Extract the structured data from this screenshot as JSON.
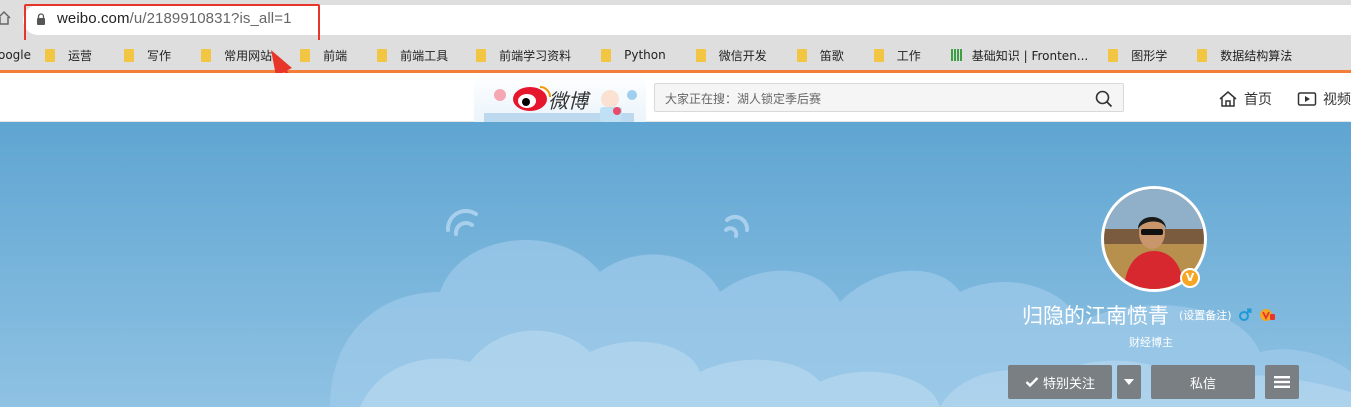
{
  "browser": {
    "url_domain": "weibo.com",
    "url_path": "/u/2189910831?is_all=1",
    "bookmarks": [
      {
        "label": "oogle",
        "icon": "none"
      },
      {
        "label": "运营",
        "icon": "folder-icon"
      },
      {
        "label": "写作",
        "icon": "folder-icon"
      },
      {
        "label": "常用网站",
        "icon": "folder-icon"
      },
      {
        "label": "前端",
        "icon": "folder-icon"
      },
      {
        "label": "前端工具",
        "icon": "folder-icon"
      },
      {
        "label": "前端学习资料",
        "icon": "folder-icon"
      },
      {
        "label": "Python",
        "icon": "folder-icon"
      },
      {
        "label": "微信开发",
        "icon": "folder-icon"
      },
      {
        "label": "笛歌",
        "icon": "folder-icon"
      },
      {
        "label": "工作",
        "icon": "folder-icon"
      },
      {
        "label": "基础知识 | Fronten...",
        "icon": "site-favicon"
      },
      {
        "label": "图形学",
        "icon": "folder-icon"
      },
      {
        "label": "数据结构算法",
        "icon": "folder-icon"
      }
    ],
    "accent_color": "#f57d3a",
    "highlight_color": "#e8352a"
  },
  "weibo": {
    "logo_text": "微博",
    "search_placeholder": "大家正在搜：湖人锁定季后赛",
    "nav": {
      "home_label": "首页",
      "video_label": "视频"
    }
  },
  "profile": {
    "username": "归隐的江南愤青",
    "set_remark": "(设置备注)",
    "subtitle": "财经博主",
    "verified_badge": "V",
    "buttons": {
      "follow": "特别关注",
      "message": "私信"
    },
    "cover_color": "#6eaed6"
  }
}
